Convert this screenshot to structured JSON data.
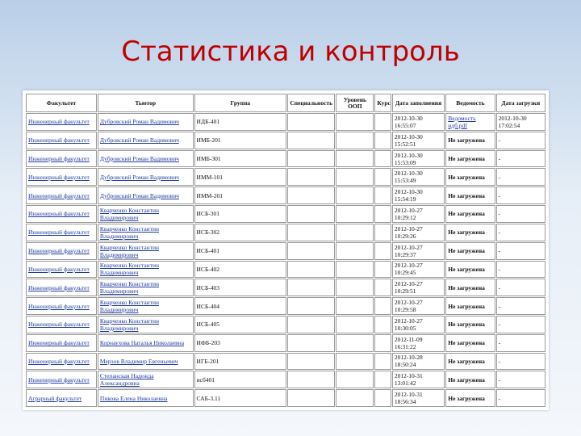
{
  "title": "Статистика и контроль",
  "table": {
    "headers": [
      "Факультет",
      "Тьютор",
      "Группа",
      "Специальность",
      "Уровень ООП",
      "Курс",
      "Дата заполнения",
      "Ведомость",
      "Дата загрузки"
    ],
    "rows": [
      {
        "faculty": "Инженерный факультет",
        "tutor": "Дубровский Роман Вадимович",
        "group": "ИДБ-401",
        "date_fill": "2012-10-30 16:55:07",
        "statement": "Ведомость идб.pdf",
        "upload": "2012-10-30 17:02:54"
      },
      {
        "faculty": "Инженерный факультет",
        "tutor": "Дубровский Роман Вадимович",
        "group": "ИМБ-201",
        "date_fill": "2012-10-30 15:52:51",
        "statement": "Не загружена",
        "upload": "-"
      },
      {
        "faculty": "Инженерный факультет",
        "tutor": "Дубровский Роман Вадимович",
        "group": "ИМБ-301",
        "date_fill": "2012-10-30 15:53:09",
        "statement": "Не загружена",
        "upload": "-"
      },
      {
        "faculty": "Инженерный факультет",
        "tutor": "Дубровский Роман Вадимович",
        "group": "ИММ-101",
        "date_fill": "2012-10-30 15:53:49",
        "statement": "Не загружена",
        "upload": "-"
      },
      {
        "faculty": "Инженерный факультет",
        "tutor": "Дубровский Роман Вадимович",
        "group": "ИММ-201",
        "date_fill": "2012-10-30 15:54:19",
        "statement": "Не загружена",
        "upload": "-"
      },
      {
        "faculty": "Инженерный факультет",
        "tutor": "Кварченко Константин Владимирович",
        "group": "ИСБ-301",
        "date_fill": "2012-10-27 10:29:12",
        "statement": "Не загружена",
        "upload": "-"
      },
      {
        "faculty": "Инженерный факультет",
        "tutor": "Кварченко Константин Владимирович",
        "group": "ИСБ-302",
        "date_fill": "2012-10-27 10:29:26",
        "statement": "Не загружена",
        "upload": "-"
      },
      {
        "faculty": "Инженерный факультет",
        "tutor": "Кварченко Константин Владимирович",
        "group": "ИСБ-401",
        "date_fill": "2012-10-27 10:29:37",
        "statement": "Не загружена",
        "upload": "-"
      },
      {
        "faculty": "Инженерный факультет",
        "tutor": "Кварченко Константин Владимирович",
        "group": "ИСБ-402",
        "date_fill": "2012-10-27 10:29:45",
        "statement": "Не загружена",
        "upload": "-"
      },
      {
        "faculty": "Инженерный факультет",
        "tutor": "Кварченко Константин Владимирович",
        "group": "ИСБ-403",
        "date_fill": "2012-10-27 10:29:51",
        "statement": "Не загружена",
        "upload": "-"
      },
      {
        "faculty": "Инженерный факультет",
        "tutor": "Кварченко Константин Владимирович",
        "group": "ИСБ-404",
        "date_fill": "2012-10-27 10:29:58",
        "statement": "Не загружена",
        "upload": "-"
      },
      {
        "faculty": "Инженерный факультет",
        "tutor": "Кварченко Константин Владимирович",
        "group": "ИСБ-405",
        "date_fill": "2012-10-27 10:30:05",
        "statement": "Не загружена",
        "upload": "-"
      },
      {
        "faculty": "Инженерный факультет",
        "tutor": "Корнаухова Наталья Николаевна",
        "group": "ИФБ-203",
        "date_fill": "2012-11-09 16:31:22",
        "statement": "Не загружена",
        "upload": "-"
      },
      {
        "faculty": "Инженерный факультет",
        "tutor": "Мерзов Владимир Евгеньевич",
        "group": "ИГБ-201",
        "date_fill": "2012-10-28 18:50:24",
        "statement": "Не загружена",
        "upload": "-"
      },
      {
        "faculty": "Инженерный факультет",
        "tutor": "Степанская Надежда Александровна",
        "group": "исб401",
        "date_fill": "2012-10-31 13:01:42",
        "statement": "Не загружена",
        "upload": "-"
      },
      {
        "faculty": "Аграрный факультет",
        "tutor": "Пикова Елена Николаевна",
        "group": "САБ-3.11",
        "date_fill": "2012-10-31 18:56:34",
        "statement": "Не загружена",
        "upload": "-"
      }
    ]
  },
  "colors": {
    "title": "#c00000",
    "link": "#1f3a9e"
  }
}
